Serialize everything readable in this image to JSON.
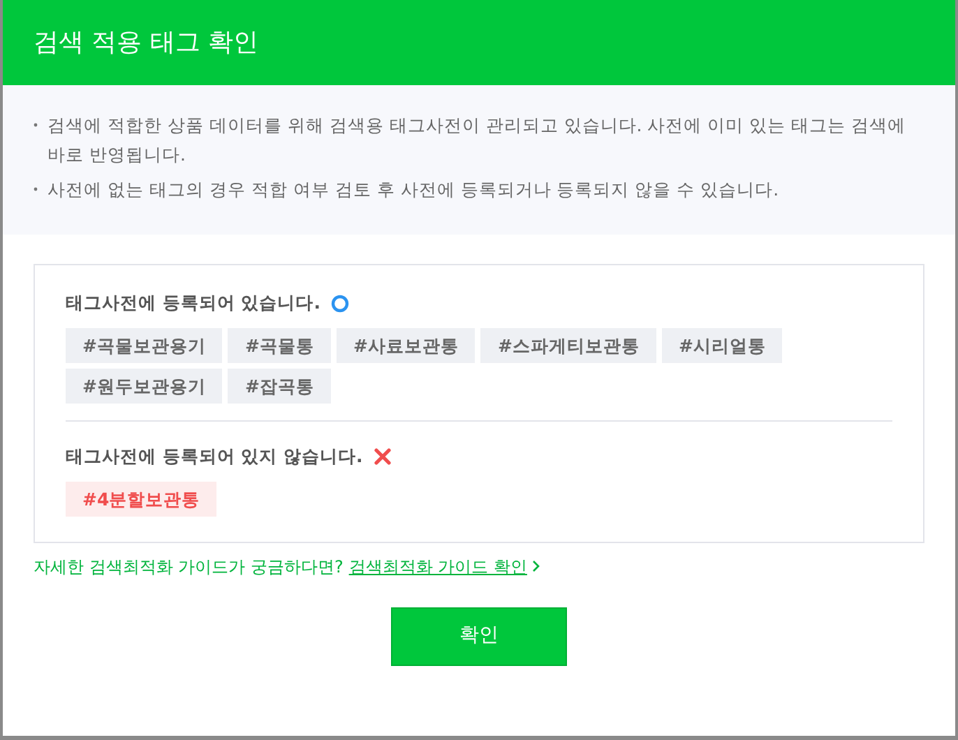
{
  "window": {
    "title": "검색 적용 태그 확인"
  },
  "notices": [
    "검색에 적합한 상품 데이터를 위해 검색용 태그사전이 관리되고 있습니다. 사전에 이미 있는 태그는 검색에 바로 반영됩니다.",
    "사전에 없는 태그의 경우 적합 여부 검토 후 사전에 등록되거나 등록되지 않을 수 있습니다."
  ],
  "sections": [
    {
      "kind": "registered",
      "heading": "태그사전에 등록되어 있습니다.",
      "tags": [
        "#곡물보관용기",
        "#곡물통",
        "#사료보관통",
        "#스파게티보관통",
        "#시리얼통",
        "#원두보관용기",
        "#잡곡통"
      ]
    },
    {
      "kind": "unregistered",
      "heading": "태그사전에 등록되어 있지 않습니다.",
      "tags": [
        "#4분할보관통"
      ]
    }
  ],
  "guide": {
    "text": "자세한 검색최적화 가이드가 궁금하다면?",
    "link": "검색최적화 가이드 확인"
  },
  "buttons": [
    "확인"
  ]
}
